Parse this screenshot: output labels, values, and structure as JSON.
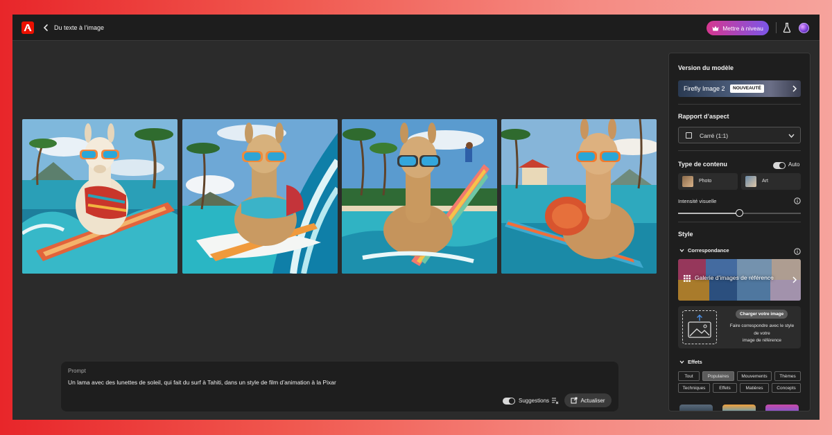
{
  "header": {
    "title": "Du texte à l’image",
    "upgrade_label": "Mettre à niveau"
  },
  "gallery": {
    "images": [
      {
        "subject": "llama-surfing-orange-board"
      },
      {
        "subject": "llama-surfing-wave"
      },
      {
        "subject": "llama-surfing-beach-surfer"
      },
      {
        "subject": "llama-surfing-backpack"
      }
    ]
  },
  "prompt": {
    "label": "Prompt",
    "text": "Un lama avec des lunettes de soleil, qui fait du surf à Tahiti, dans un style de film d’animation à la Pixar",
    "suggestions_label": "Suggestions",
    "suggestions_on": true,
    "refresh_label": "Actualiser"
  },
  "panel": {
    "model_heading": "Version du modèle",
    "model_name": "Firefly Image 2",
    "model_badge": "NOUVEAUTÉ",
    "aspect_heading": "Rapport d’aspect",
    "aspect_value": "Carré (1:1)",
    "content_type_heading": "Type de contenu",
    "auto_label": "Auto",
    "auto_on": true,
    "content_types": [
      {
        "label": "Photo"
      },
      {
        "label": "Art"
      }
    ],
    "intensity_label": "Intensité visuelle",
    "intensity_value": 0.5,
    "style_heading": "Style",
    "match_heading": "Correspondance",
    "ref_gallery_label": "Galerie d’images de référence",
    "upload_button": "Charger votre image",
    "upload_desc_1": "Faire correspondre avec le style",
    "upload_desc_2": "de votre",
    "upload_desc_3": "image de référence",
    "effects_heading": "Effets",
    "effect_tabs": [
      {
        "label": "Tout",
        "active": false
      },
      {
        "label": "Populaires",
        "active": true
      },
      {
        "label": "Mouvements",
        "active": false
      },
      {
        "label": "Thèmes",
        "active": false
      },
      {
        "label": "Techniques",
        "active": false
      },
      {
        "label": "Effets",
        "active": false
      },
      {
        "label": "Matières",
        "active": false
      },
      {
        "label": "Concepts",
        "active": false
      }
    ]
  },
  "colors": {
    "accent_gradient_start": "#d6378f",
    "accent_gradient_end": "#7b56e8",
    "adobe_red": "#eb1000",
    "panel_bg": "#1e1e1e",
    "canvas_bg": "#2b2b2b"
  }
}
